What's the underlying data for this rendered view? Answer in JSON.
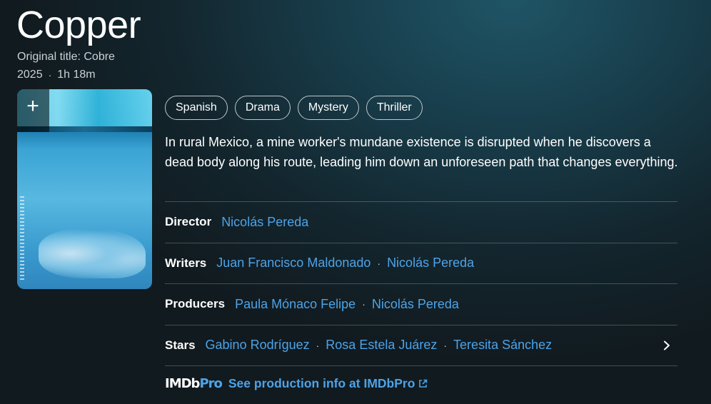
{
  "movie": {
    "title": "Copper",
    "original_title": "Original title: Cobre",
    "year": "2025",
    "separator": "·",
    "runtime": "1h 18m"
  },
  "poster": {
    "add_icon": "plus-icon",
    "add_glyph": "+"
  },
  "genres": [
    "Spanish",
    "Drama",
    "Mystery",
    "Thriller"
  ],
  "plot": "In rural Mexico, a mine worker's mundane existence is disrupted when he discovers a dead body along his route, leading him down an unforeseen path that changes everything.",
  "credits": {
    "director": {
      "label": "Director",
      "names": [
        "Nicolás Pereda"
      ]
    },
    "writers": {
      "label": "Writers",
      "names": [
        "Juan Francisco Maldonado",
        "Nicolás Pereda"
      ]
    },
    "producers": {
      "label": "Producers",
      "names": [
        "Paula Mónaco Felipe",
        "Nicolás Pereda"
      ]
    },
    "stars": {
      "label": "Stars",
      "names": [
        "Gabino Rodríguez",
        "Rosa Estela Juárez",
        "Teresita Sánchez"
      ]
    },
    "dot": "·"
  },
  "imdbpro": {
    "logo_imdb": "IMDb",
    "logo_pro": "Pro",
    "link_label": "See production info at IMDbPro",
    "icon": "external-link-icon"
  },
  "colors": {
    "link": "#4da3e8",
    "text": "#ffffff",
    "muted": "#c9d1d5"
  }
}
